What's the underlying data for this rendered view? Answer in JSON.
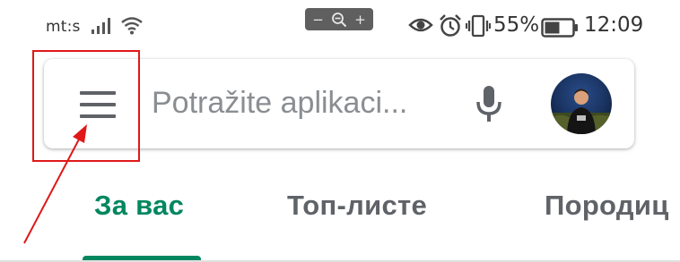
{
  "status_bar": {
    "carrier": "mt:s",
    "zoom_controls": {
      "minus": "−",
      "plus": "+"
    },
    "battery_percent": "55%",
    "time": "12:09",
    "icons": [
      "signal-icon",
      "wifi-icon",
      "eye-icon",
      "alarm-icon",
      "vibrate-icon",
      "battery-icon"
    ],
    "battery_level": 0.55
  },
  "search": {
    "placeholder": "Potražite aplikaci...",
    "icons": [
      "menu-icon",
      "mic-icon",
      "avatar"
    ]
  },
  "tabs": [
    {
      "label": "За вас",
      "active": true
    },
    {
      "label": "Топ-листе",
      "active": false
    },
    {
      "label": "Породиц",
      "active": false
    }
  ],
  "colors": {
    "accent": "#01875f",
    "annotation": "#e01818",
    "icon": "#5f6368",
    "placeholder": "#8a8e92"
  }
}
